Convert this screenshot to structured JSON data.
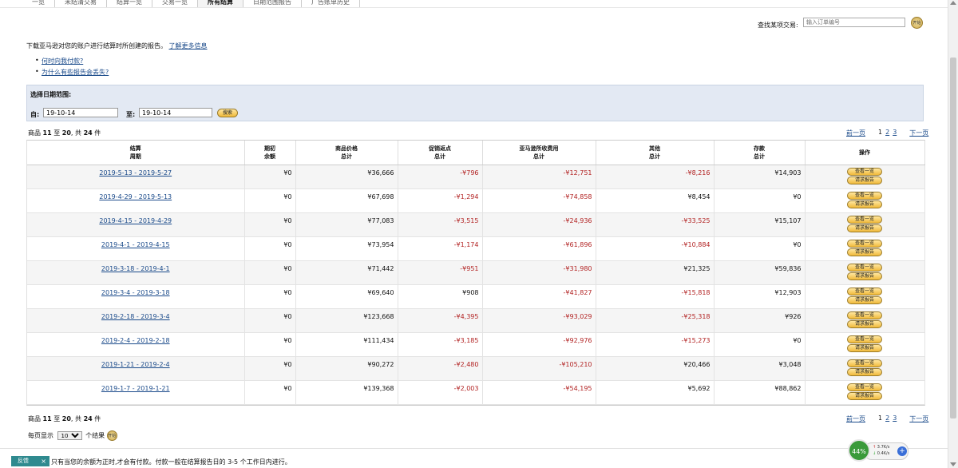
{
  "tabs": [
    {
      "label": "一览"
    },
    {
      "label": "未结清交易"
    },
    {
      "label": "结算一览"
    },
    {
      "label": "交易一览"
    },
    {
      "label": "所有结算",
      "active": true
    },
    {
      "label": "日期范围报告"
    },
    {
      "label": "广告账单历史"
    }
  ],
  "find": {
    "label": "查找某项交易:",
    "placeholder": "输入订单编号",
    "go": "开始"
  },
  "intro": {
    "text": "下载亚马逊对您的账户进行结算时所创建的报告。",
    "link": "了解更多信息"
  },
  "bullets": [
    "何时向我付款?",
    "为什么有些报告会丢失?"
  ],
  "date_range": {
    "title": "选择日期范围:",
    "from_label": "自:",
    "from_value": "19-10-14",
    "to_label": "至:",
    "to_value": "19-10-14",
    "search": "搜索"
  },
  "count": {
    "prefix": "商品",
    "from": "11",
    "mid": "至",
    "to": "20",
    "sep": ", 共",
    "total": "24",
    "suffix": "件"
  },
  "pager": {
    "prev": "前一页",
    "p1": "1",
    "p2": "2",
    "p3": "3",
    "next": "下一页"
  },
  "columns": [
    {
      "l1": "结算",
      "l2": "周期"
    },
    {
      "l1": "期初",
      "l2": "余额"
    },
    {
      "l1": "商品价格",
      "l2": "总计"
    },
    {
      "l1": "促销返点",
      "l2": "总计"
    },
    {
      "l1": "亚马逊所收费用",
      "l2": "总计"
    },
    {
      "l1": "其他",
      "l2": "总计"
    },
    {
      "l1": "存款",
      "l2": "总计"
    },
    {
      "l1": "操作",
      "l2": ""
    }
  ],
  "rows": [
    {
      "period": "2019-5-13 - 2019-5-27",
      "opening": "¥0",
      "price": "¥36,666",
      "promo": "-¥796",
      "fees": "-¥12,751",
      "other": "-¥8,216",
      "deposit": "¥14,903"
    },
    {
      "period": "2019-4-29 - 2019-5-13",
      "opening": "¥0",
      "price": "¥67,698",
      "promo": "-¥1,294",
      "fees": "-¥74,858",
      "other": "¥8,454",
      "deposit": "¥0"
    },
    {
      "period": "2019-4-15 - 2019-4-29",
      "opening": "¥0",
      "price": "¥77,083",
      "promo": "-¥3,515",
      "fees": "-¥24,936",
      "other": "-¥33,525",
      "deposit": "¥15,107"
    },
    {
      "period": "2019-4-1 - 2019-4-15",
      "opening": "¥0",
      "price": "¥73,954",
      "promo": "-¥1,174",
      "fees": "-¥61,896",
      "other": "-¥10,884",
      "deposit": "¥0"
    },
    {
      "period": "2019-3-18 - 2019-4-1",
      "opening": "¥0",
      "price": "¥71,442",
      "promo": "-¥951",
      "fees": "-¥31,980",
      "other": "¥21,325",
      "deposit": "¥59,836"
    },
    {
      "period": "2019-3-4 - 2019-3-18",
      "opening": "¥0",
      "price": "¥69,640",
      "promo": "¥908",
      "fees": "-¥41,827",
      "other": "-¥15,818",
      "deposit": "¥12,903"
    },
    {
      "period": "2019-2-18 - 2019-3-4",
      "opening": "¥0",
      "price": "¥123,668",
      "promo": "-¥4,395",
      "fees": "-¥93,029",
      "other": "-¥25,318",
      "deposit": "¥926"
    },
    {
      "period": "2019-2-4 - 2019-2-18",
      "opening": "¥0",
      "price": "¥111,434",
      "promo": "-¥3,185",
      "fees": "-¥92,976",
      "other": "-¥15,273",
      "deposit": "¥0"
    },
    {
      "period": "2019-1-21 - 2019-2-4",
      "opening": "¥0",
      "price": "¥90,272",
      "promo": "-¥2,480",
      "fees": "-¥105,210",
      "other": "¥20,466",
      "deposit": "¥3,048"
    },
    {
      "period": "2019-1-7 - 2019-1-21",
      "opening": "¥0",
      "price": "¥139,368",
      "promo": "-¥2,003",
      "fees": "-¥54,195",
      "other": "¥5,692",
      "deposit": "¥88,862"
    }
  ],
  "row_actions": {
    "view": "查看一览",
    "request": "请求报告"
  },
  "per_page": {
    "label": "每页显示",
    "value": "10",
    "suffix": "个结果",
    "go": "开始"
  },
  "footer": {
    "feedback": "反馈",
    "close": "×",
    "note": "只有当您的余额为正时,才会有付款。付款一般在结算报告日的 3-5 个工作日内进行。"
  },
  "speed_widget": {
    "percent": "44%",
    "up": "3.7K/s",
    "down": "0.4K/s",
    "plus": "+"
  },
  "colors": {
    "negative": "#b22222",
    "link": "#1a4a8a",
    "date_panel": "#e3e9f3",
    "button": "#f0b93a"
  }
}
